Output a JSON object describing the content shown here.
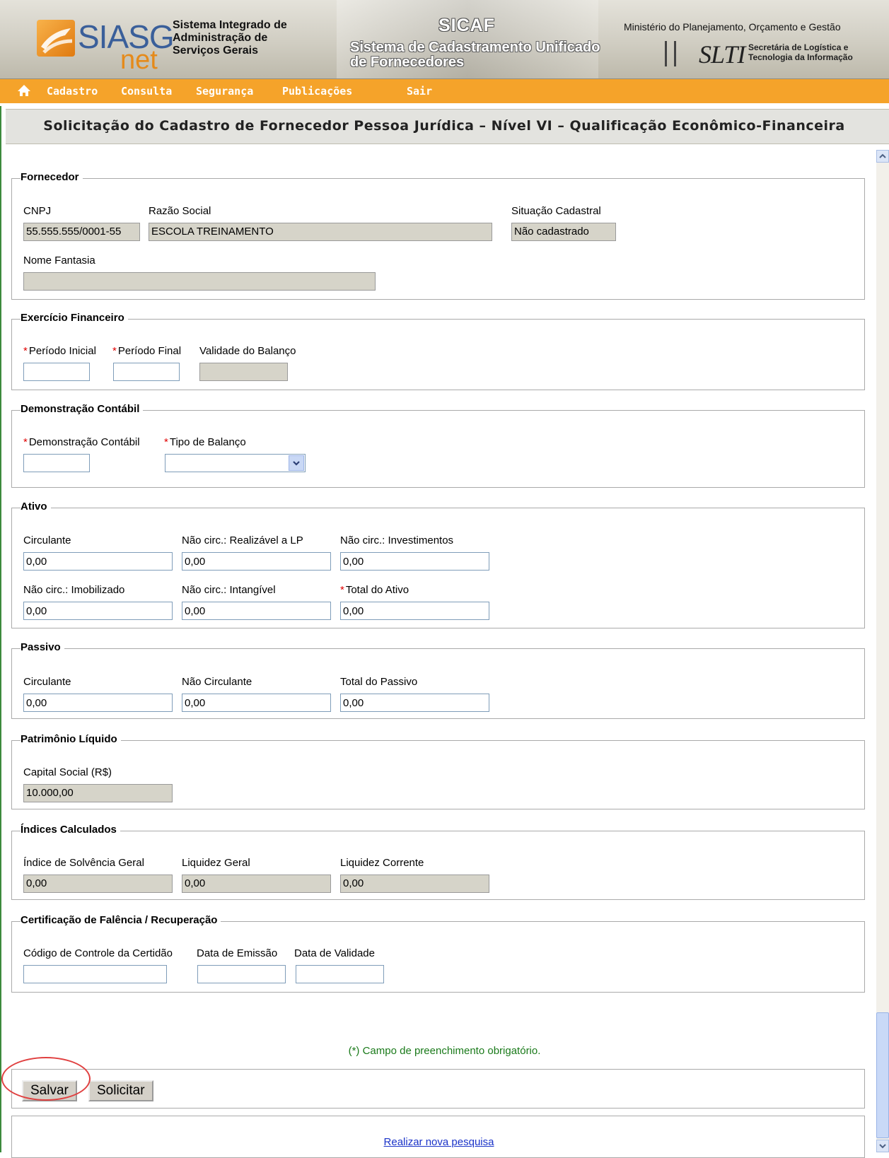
{
  "header": {
    "logo_text": "SIASG",
    "logo_sub": "net",
    "system_name": "Sistema Integrado de Administração de Serviços Gerais",
    "sicaf_short": "SICAF",
    "sicaf_full": "Sistema de Cadastramento Unificado de Fornecedores",
    "ministry": "Ministério do Planejamento, Orçamento e Gestão",
    "slti_logo": "SLTI",
    "slti_desc_line1": "Secretária de Logística e",
    "slti_desc_line2": "Tecnologia da Informação"
  },
  "menu": {
    "home_icon": "home-icon",
    "items": [
      "Cadastro",
      "Consulta",
      "Segurança",
      "Publicações",
      "Sair"
    ]
  },
  "page_title": "Solicitação do Cadastro de Fornecedor Pessoa Jurídica – Nível VI – Qualificação Econômico-Financeira",
  "fornecedor": {
    "legend": "Fornecedor",
    "cnpj_label": "CNPJ",
    "cnpj_value": "55.555.555/0001-55",
    "razao_label": "Razão Social",
    "razao_value": "ESCOLA TREINAMENTO",
    "situacao_label": "Situação Cadastral",
    "situacao_value": "Não cadastrado",
    "fantasia_label": "Nome Fantasia",
    "fantasia_value": ""
  },
  "exercicio": {
    "legend": "Exercício Financeiro",
    "required_mark": "*",
    "periodo_inicial_label": "Período Inicial",
    "periodo_final_label": "Período Final",
    "validade_label": "Validade do Balanço"
  },
  "demonstracao": {
    "legend": "Demonstração Contábil",
    "required_mark": "*",
    "demonstracao_label": "Demonstração Contábil",
    "tipo_label": "Tipo de Balanço",
    "tipo_value": ""
  },
  "ativo": {
    "legend": "Ativo",
    "required_mark": "*",
    "circulante_label": "Circulante",
    "circulante_value": "0,00",
    "realizavel_label": "Não circ.: Realizável a LP",
    "realizavel_value": "0,00",
    "investimentos_label": "Não circ.: Investimentos",
    "investimentos_value": "0,00",
    "imobilizado_label": "Não circ.: Imobilizado",
    "imobilizado_value": "0,00",
    "intangivel_label": "Não circ.: Intangível",
    "intangivel_value": "0,00",
    "total_label": "Total do Ativo",
    "total_value": "0,00"
  },
  "passivo": {
    "legend": "Passivo",
    "circulante_label": "Circulante",
    "circulante_value": "0,00",
    "nao_circulante_label": "Não Circulante",
    "nao_circulante_value": "0,00",
    "total_label": "Total do Passivo",
    "total_value": "0,00"
  },
  "patrimonio": {
    "legend": "Patrimônio Líquido",
    "capital_label": "Capital Social (R$)",
    "capital_value": "10.000,00"
  },
  "indices": {
    "legend": "Índices Calculados",
    "solvencia_label": "Índice de Solvência Geral",
    "solvencia_value": "0,00",
    "liquidez_geral_label": "Liquidez Geral",
    "liquidez_geral_value": "0,00",
    "liquidez_corrente_label": "Liquidez Corrente",
    "liquidez_corrente_value": "0,00"
  },
  "certificacao": {
    "legend": "Certificação de Falência / Recuperação",
    "codigo_label": "Código de Controle da Certidão",
    "emissao_label": "Data de Emissão",
    "validade_label": "Data de Validade"
  },
  "required_note": "(*) Campo de preenchimento obrigatório.",
  "buttons": {
    "salvar": "Salvar",
    "solicitar": "Solicitar"
  },
  "new_search_link": "Realizar nova pesquisa",
  "colors": {
    "menu_bg": "#f5a32a",
    "required": "#e00000",
    "note": "#1a7a1a",
    "link": "#1a33c8",
    "annotation": "#e04040"
  }
}
